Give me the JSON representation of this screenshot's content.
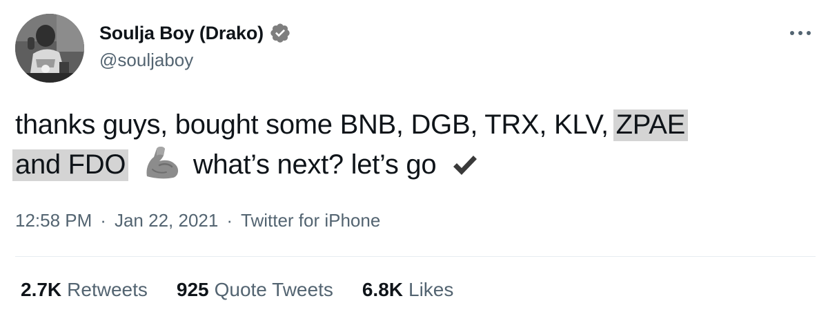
{
  "user": {
    "display_name": "Soulja Boy (Drako)",
    "handle": "@souljaboy",
    "verified": true
  },
  "tweet": {
    "line1_plain": "thanks guys, bought some BNB, DGB, TRX, KLV,",
    "line1_highlight": "ZPAE",
    "line2_highlight": "and FDO",
    "line2_plain": "what’s next? let’s go",
    "emojis": [
      "flexed-biceps",
      "heavy-check-mark"
    ]
  },
  "meta": {
    "time": "12:58 PM",
    "date": "Jan 22, 2021",
    "source": "Twitter for iPhone",
    "separator": "·"
  },
  "stats": {
    "retweets": {
      "count": "2.7K",
      "label": "Retweets"
    },
    "quotes": {
      "count": "925",
      "label": "Quote Tweets"
    },
    "likes": {
      "count": "6.8K",
      "label": "Likes"
    }
  },
  "colors": {
    "text": "#0f1419",
    "secondary": "#536471",
    "highlight": "#d4d4d4"
  }
}
